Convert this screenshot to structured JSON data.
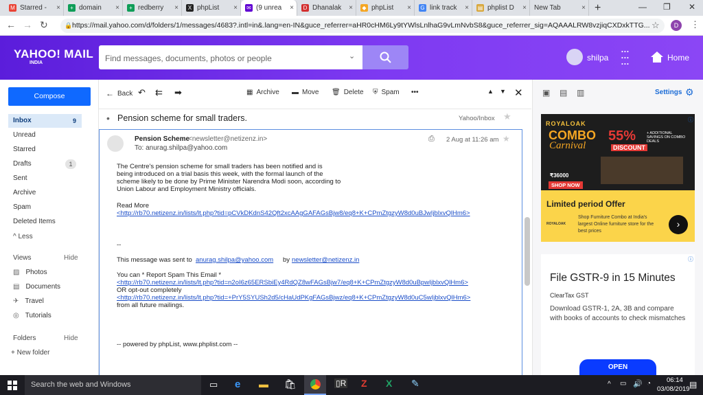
{
  "browser": {
    "tabs": [
      {
        "label": "Starred -",
        "icon": "gmail-icon",
        "color": "#ea4335",
        "glyph": "M"
      },
      {
        "label": "domain",
        "icon": "sheets-icon",
        "color": "#0f9d58",
        "glyph": "+"
      },
      {
        "label": "redberry",
        "icon": "sheets-icon",
        "color": "#0f9d58",
        "glyph": "+"
      },
      {
        "label": "phpList",
        "icon": "phplist-icon",
        "color": "#222222",
        "glyph": "X"
      },
      {
        "label": "(9 unrea",
        "icon": "yahoo-mail-icon",
        "color": "#6001d2",
        "glyph": "✉"
      },
      {
        "label": "Dhanalak",
        "icon": "dhanalakshmi-icon",
        "color": "#d32f2f",
        "glyph": "D"
      },
      {
        "label": "phpList",
        "icon": "phplist-icon",
        "color": "#f5a623",
        "glyph": "◆"
      },
      {
        "label": "link track",
        "icon": "google-icon",
        "color": "#4285f4",
        "glyph": "G"
      },
      {
        "label": "phplist D",
        "icon": "doc-icon",
        "color": "#d8a73b",
        "glyph": "▤"
      },
      {
        "label": "New Tab",
        "icon": "",
        "color": "",
        "glyph": ""
      }
    ],
    "url": "https://mail.yahoo.com/d/folders/1/messages/4683?.intl=in&.lang=en-IN&guce_referrer=aHR0cHM6Ly9tYWlsLnlhaG9vLmNvbS8&guce_referrer_sig=AQAAALRW8vzjiqCXDxkTTG...",
    "profile_initial": "D"
  },
  "yahoo": {
    "logo": "YAHOO! MAIL",
    "logo_sub": "INDIA",
    "search_placeholder": "Find messages, documents, photos or people",
    "user_name": "shilpa",
    "home_label": "Home"
  },
  "sidebar": {
    "compose": "Compose",
    "folders": [
      {
        "label": "Inbox",
        "count": "9"
      },
      {
        "label": "Unread",
        "count": ""
      },
      {
        "label": "Starred",
        "count": ""
      },
      {
        "label": "Drafts",
        "count": "1"
      },
      {
        "label": "Sent",
        "count": ""
      },
      {
        "label": "Archive",
        "count": ""
      },
      {
        "label": "Spam",
        "count": ""
      },
      {
        "label": "Deleted Items",
        "count": ""
      }
    ],
    "less": "Less",
    "views": "Views",
    "views_hide": "Hide",
    "view_items": [
      "Photos",
      "Documents",
      "Travel",
      "Tutorials"
    ],
    "folders_label": "Folders",
    "folders_hide": "Hide",
    "new_folder": "+ New folder"
  },
  "toolbar": {
    "back": "Back",
    "archive": "Archive",
    "move": "Move",
    "delete": "Delete",
    "spam": "Spam",
    "more": "•••",
    "settings": "Settings"
  },
  "message": {
    "subject": "Pension scheme for small traders.",
    "folder": "Yahoo/Inbox",
    "sender_name": "Pension Scheme",
    "sender_email": "<newsletter@netizenz.in>",
    "to": "To: anurag.shilpa@yahoo.com",
    "date": "2 Aug at 11:26 am",
    "body_lines": [
      "The Centre's pension scheme for small traders has been notified and is",
      "being introduced on a trial basis this week, with the formal launch of the",
      "scheme likely to be done by Prime Minister Narendra Modi soon, according to",
      "Union Labour and Employment Ministry officials."
    ],
    "read_more": "Read More",
    "read_more_link": "<http://rb70.netizenz.in/lists/lt.php?tid=pCVkDKdnS42Qft2xcAAgGAFAGsBjw8/eq8+K+CPmZtgzyW8d0uBJwIjblxvQlHm6>",
    "sig_dash": "--",
    "sent_to_prefix": "This message was sent to",
    "sent_to_email": "anurag.shilpa@yahoo.com",
    "by": "by",
    "by_email": "newsletter@netizenz.in",
    "report": "You can * Report Spam This Email *",
    "report_link": "<http://rb70.netizenz.in/lists/lt.php?tid=n2oI6z65ERSbiEy4RdQZ8wFAGsBjw7/eq8+K+CPmZtgzyW8d0uBpwIjblxvQlHm6>",
    "optout": "OR opt-out completely",
    "optout_link": "<http://rb70.netizenz.in/lists/lt.php?tid=+PrY5SYUSh2d5/cHaUdPKgFAGsBjwz/eq8+K+CPmZtgzyW8d0uC5wIjblxvQlHm6>",
    "all_future": "from all future mailings.",
    "powered": "-- powered by phpList, www.phplist.com --"
  },
  "ads": {
    "ad1_brand": "ROYALOAK",
    "ad1_combo": "COMBO",
    "ad1_carnival": "Carnival",
    "ad1_pct": "55%",
    "ad1_discount": "DISCOUNT",
    "ad1_extra": "+ ADDITIONAL SAVINGS ON COMBO DEALS",
    "ad1_price": "₹36000",
    "ad1_shop": "SHOP NOW",
    "ad1_headline": "Limited period Offer",
    "ad1_logo": "ROYALOAK",
    "ad1_desc": "Shop Furniture Combo at India's largest Online furniture store for the best prices",
    "ad2_title": "File GSTR-9 in 15 Minutes",
    "ad2_brand": "ClearTax GST",
    "ad2_desc": "Download GSTR-1, 2A, 3B and compare with books of accounts to check mismatches",
    "ad2_cta": "OPEN"
  },
  "taskbar": {
    "search": "Search the web and Windows",
    "time": "06:14",
    "date": "03/08/2019"
  }
}
